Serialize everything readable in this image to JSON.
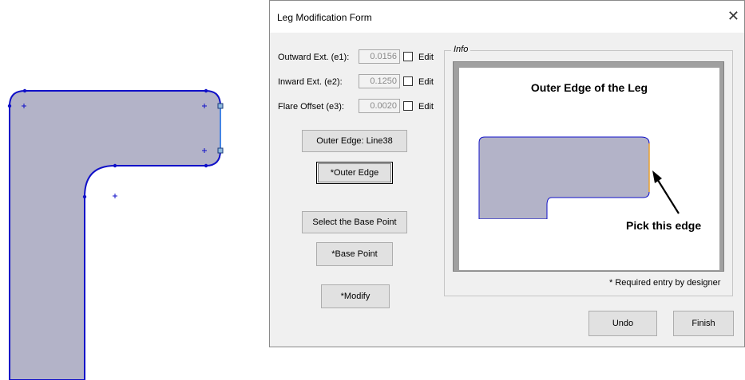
{
  "dialog": {
    "title": "Leg Modification Form",
    "close_glyph": "✕",
    "fields": [
      {
        "label": "Outward Ext. (e1):",
        "value": "0.0156",
        "edit_label": "Edit"
      },
      {
        "label": "Inward Ext. (e2):",
        "value": "0.1250",
        "edit_label": "Edit"
      },
      {
        "label": "Flare Offset (e3):",
        "value": "0.0020",
        "edit_label": "Edit"
      }
    ],
    "outer_edge_display": "Outer Edge: Line38",
    "outer_edge_button": "*Outer Edge",
    "base_point_display": "Select the Base Point",
    "base_point_button": "*Base Point",
    "modify_button": "*Modify",
    "info": {
      "legend": "Info",
      "image_title": "Outer Edge of the Leg",
      "image_label": "Pick this edge"
    },
    "required_note": "* Required entry by designer",
    "undo_button": "Undo",
    "finish_button": "Finish"
  },
  "colors": {
    "part_fill": "#b3b3c8",
    "edge_blue": "#1010c8",
    "selected_edge": "#e8a030",
    "dialog_bg": "#f0f0f0"
  }
}
